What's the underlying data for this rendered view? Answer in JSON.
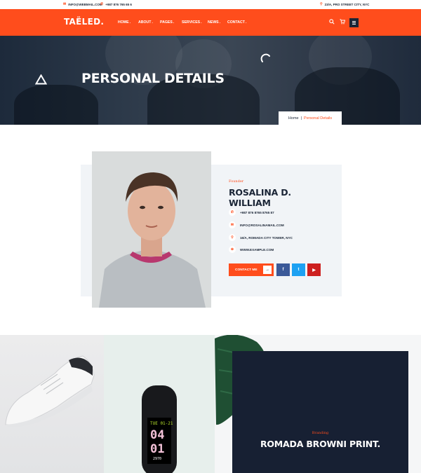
{
  "topbar": {
    "email": "INFO@WEBMAIL.COM",
    "phone": "+987 876 765 65 6",
    "address": "23/A, PRO STREET CITY, NYC",
    "icons": [
      "mail-icon",
      "phone-icon",
      "location-pin-icon"
    ]
  },
  "nav": {
    "logo": "TAËLED.",
    "menu": [
      {
        "label": "HOME",
        "suffix": "."
      },
      {
        "label": "ABOUT",
        "suffix": "."
      },
      {
        "label": "PAGES",
        "suffix": "."
      },
      {
        "label": "SERVICES",
        "suffix": "."
      },
      {
        "label": "NEWS",
        "suffix": "."
      },
      {
        "label": "CONTACT",
        "suffix": "."
      }
    ],
    "icons": [
      "search-icon",
      "cart-icon",
      "menu-icon"
    ]
  },
  "hero": {
    "title": "PERSONAL DETAILS",
    "breadcrumb": {
      "home": "Home",
      "separator": "|",
      "current": "Personal Details"
    }
  },
  "profile": {
    "role": "Founder",
    "name": "ROSALINA D. WILLIAM",
    "contacts": [
      {
        "icon": "phone-icon",
        "text": "+987 876 8765 8765 87"
      },
      {
        "icon": "mail-icon",
        "text": "INFO@ROSALINAMAIL.COM"
      },
      {
        "icon": "location-pin-icon",
        "text": "16/A, ROMADA CITY TOWER, NYC"
      },
      {
        "icon": "globe-icon",
        "text": "WWW.EXAMPLE.COM"
      }
    ],
    "contact_button": "CONTACT ME",
    "social": [
      {
        "name": "facebook-icon",
        "glyph": "f",
        "color": "#3b5998"
      },
      {
        "name": "twitter-icon",
        "glyph": "t",
        "color": "#1da1f2"
      },
      {
        "name": "youtube-icon",
        "glyph": "▶",
        "color": "#cd201f"
      }
    ]
  },
  "portfolio": {
    "category": "Branding",
    "title": "ROMADA BROWNI PRINT.",
    "watch_display": {
      "top": "TUE 01-21",
      "hours": "04",
      "minutes": "01",
      "bottom": "2970"
    }
  },
  "colors": {
    "accent": "#ff4d1c",
    "navy": "#172033",
    "light": "#f1f4f7"
  }
}
